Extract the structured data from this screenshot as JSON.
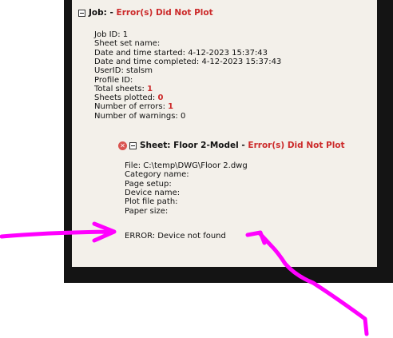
{
  "job": {
    "heading_label": "Job:",
    "heading_sep": " - ",
    "status": "Error(s) Did Not Plot",
    "details": [
      {
        "label": "Job ID: ",
        "value": "1",
        "highlight": false
      },
      {
        "label": "Sheet set name:",
        "value": "",
        "highlight": false
      },
      {
        "label": "Date and time started: ",
        "value": "4-12-2023 15:37:43",
        "highlight": false
      },
      {
        "label": "Date and time completed: ",
        "value": "4-12-2023 15:37:43",
        "highlight": false
      },
      {
        "label": "UserID: ",
        "value": "stalsm",
        "highlight": false
      },
      {
        "label": "Profile ID:",
        "value": "",
        "highlight": false
      },
      {
        "label": "Total sheets: ",
        "value": "1",
        "highlight": true
      },
      {
        "label": "Sheets plotted: ",
        "value": "0",
        "highlight": true
      },
      {
        "label": "Number of errors: ",
        "value": "1",
        "highlight": true
      },
      {
        "label": "Number of warnings: ",
        "value": "0",
        "highlight": false
      }
    ]
  },
  "sheet": {
    "heading_label": "Sheet: Floor 2-Model",
    "heading_sep": " - ",
    "status": "Error(s) Did Not Plot",
    "details": [
      {
        "label": "File: ",
        "value": "C:\\temp\\DWG\\Floor 2.dwg"
      },
      {
        "label": "Category name:",
        "value": ""
      },
      {
        "label": "Page setup:",
        "value": ""
      },
      {
        "label": "Device name:",
        "value": ""
      },
      {
        "label": "Plot file path:",
        "value": ""
      },
      {
        "label": "Paper size:",
        "value": ""
      }
    ],
    "error_message": "ERROR: Device not found"
  },
  "colors": {
    "error_red": "#cc2a2a",
    "annotation_magenta": "#ff00ff",
    "panel_bg": "#f3f0ea",
    "frame_bg": "#141414"
  },
  "icons": {
    "collapse": "minus-box-icon",
    "error": "error-x-icon"
  }
}
